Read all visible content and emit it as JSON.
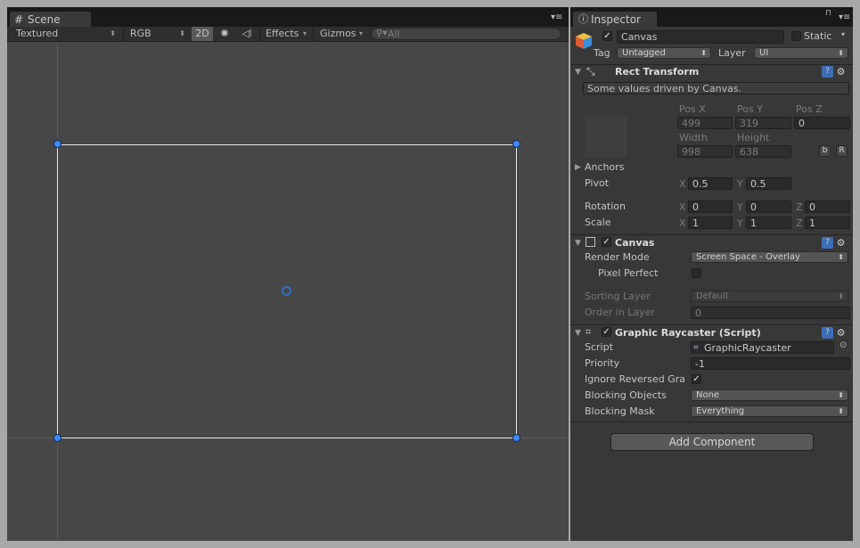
{
  "scene": {
    "tab_label": "Scene",
    "toolbar": {
      "draw_mode": "Textured",
      "render_mode": "RGB",
      "mode_2d": "2D",
      "effects": "Effects",
      "gizmos": "Gizmos",
      "search_placeholder": "All"
    }
  },
  "inspector": {
    "tab_label": "Inspector",
    "object_name": "Canvas",
    "object_active": true,
    "static_label": "Static",
    "tag_label": "Tag",
    "tag_value": "Untagged",
    "layer_label": "Layer",
    "layer_value": "UI",
    "rect_transform": {
      "title": "Rect Transform",
      "info": "Some values driven by Canvas.",
      "pos_x_label": "Pos X",
      "pos_y_label": "Pos Y",
      "pos_z_label": "Pos Z",
      "pos_x": "499",
      "pos_y": "319",
      "pos_z": "0",
      "width_label": "Width",
      "height_label": "Height",
      "width": "998",
      "height": "638",
      "blueprint_btn": "b",
      "raw_btn": "R",
      "anchors_label": "Anchors",
      "pivot_label": "Pivot",
      "pivot_x": "0.5",
      "pivot_y": "0.5",
      "rotation_label": "Rotation",
      "rot_x": "0",
      "rot_y": "0",
      "rot_z": "0",
      "scale_label": "Scale",
      "scale_x": "1",
      "scale_y": "1",
      "scale_z": "1",
      "x": "X",
      "y": "Y",
      "z": "Z"
    },
    "canvas": {
      "title": "Canvas",
      "enabled": true,
      "render_mode_label": "Render Mode",
      "render_mode_value": "Screen Space - Overlay",
      "pixel_perfect_label": "Pixel Perfect",
      "pixel_perfect": false,
      "sorting_layer_label": "Sorting Layer",
      "sorting_layer_value": "Default",
      "order_label": "Order in Layer",
      "order_value": "0"
    },
    "raycaster": {
      "title": "Graphic Raycaster (Script)",
      "enabled": true,
      "script_label": "Script",
      "script_value": "GraphicRaycaster",
      "priority_label": "Priority",
      "priority_value": "-1",
      "ignore_label": "Ignore Reversed Gra",
      "ignore_value": true,
      "blocking_objects_label": "Blocking Objects",
      "blocking_objects_value": "None",
      "blocking_mask_label": "Blocking Mask",
      "blocking_mask_value": "Everything"
    },
    "add_component_label": "Add Component"
  },
  "colors": {
    "selection_handle": "#3d8cff",
    "rect_outline": "#e8e8e8",
    "scene_bg": "#474747",
    "inspector_bg": "#383838"
  }
}
